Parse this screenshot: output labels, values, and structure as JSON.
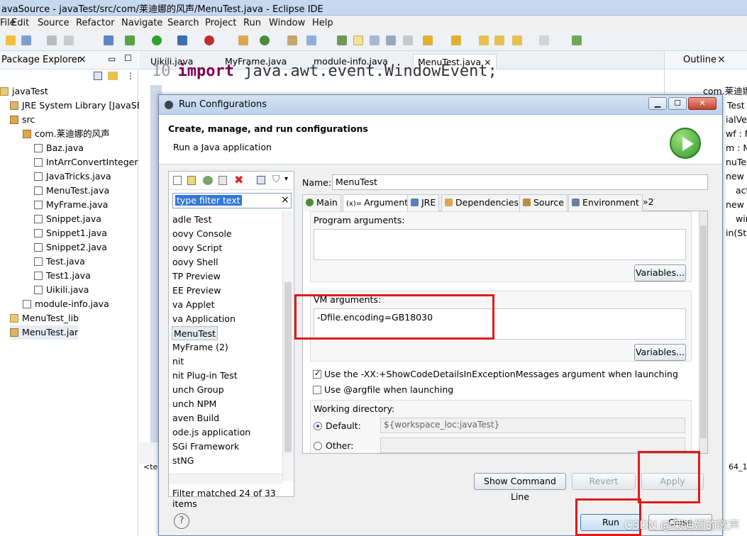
{
  "window": {
    "title": "avaSource - javaTest/src/com/莱迪娜的风声/MenuTest.java - Eclipse IDE"
  },
  "menus": [
    "File",
    "Edit",
    "Source",
    "Refactor",
    "Navigate",
    "Search",
    "Project",
    "Run",
    "Window",
    "Help"
  ],
  "package_explorer": {
    "title": "Package Explorer",
    "items": [
      {
        "label": "javaTest"
      },
      {
        "label": "JRE System Library [JavaSE-"
      },
      {
        "label": "src"
      },
      {
        "label": "com.莱迪娜的风声"
      },
      {
        "label": "Baz.java"
      },
      {
        "label": "IntArrConvertIntegerLi"
      },
      {
        "label": "JavaTricks.java"
      },
      {
        "label": "MenuTest.java"
      },
      {
        "label": "MyFrame.java"
      },
      {
        "label": "Snippet.java"
      },
      {
        "label": "Snippet1.java"
      },
      {
        "label": "Snippet2.java"
      },
      {
        "label": "Test.java"
      },
      {
        "label": "Test1.java"
      },
      {
        "label": "Uikili.java"
      },
      {
        "label": "module-info.java"
      },
      {
        "label": "MenuTest_lib"
      },
      {
        "label": "MenuTest.jar"
      }
    ]
  },
  "editor": {
    "tabs": [
      "Uikili.java",
      "MyFrame.java",
      "module-info.java",
      "MenuTest.java"
    ],
    "line_number": "10",
    "line_keyword": "import",
    "line_text": " java.awt.event.WindowEvent;"
  },
  "outline": {
    "title": "Outline",
    "items": [
      "com.莱迪娜",
      "Test",
      "ialVe",
      "wf : M",
      "m : M",
      "nuTe",
      "new A",
      "act",
      "new W",
      "wir",
      "in(Str"
    ]
  },
  "console_partial": "<te",
  "console_partial2": "64_1",
  "dialog": {
    "title": "Run Configurations",
    "header_title": "Create, manage, and run configurations",
    "header_subtitle": "Run a Java application",
    "filter_placeholder": "type filter text",
    "config_items": [
      "adle Test",
      "oovy Console",
      "oovy Script",
      "oovy Shell",
      "TP Preview",
      "EE Preview",
      "va Applet",
      "va Application",
      "MenuTest",
      "MyFrame (2)",
      "nit",
      "nit Plug-in Test",
      "unch Group",
      "unch NPM",
      "aven Build",
      "ode.js application",
      "SGi Framework",
      "stNG"
    ],
    "filter_status": "Filter matched 24 of 33 items",
    "name_label": "Name:",
    "name_value": "MenuTest",
    "tabs": [
      "Main",
      "Arguments",
      "JRE",
      "Dependencies",
      "Source",
      "Environment",
      "»2"
    ],
    "program_args_label": "Program arguments:",
    "program_args_value": "",
    "variables_label": "Variables...",
    "vm_args_label": "VM arguments:",
    "vm_args_value": "-Dfile.encoding=GB18030",
    "chk_showcode": "Use the -XX:+ShowCodeDetailsInExceptionMessages argument when launching",
    "chk_argfile": "Use @argfile when launching",
    "workdir_label": "Working directory:",
    "default_label": "Default:",
    "default_value": "${workspace_loc:javaTest}",
    "other_label": "Other:",
    "show_cmd": "Show Command Line",
    "revert": "Revert",
    "apply": "Apply",
    "run": "Run",
    "close": "Close",
    "help": "?"
  },
  "watermark": "CSDN @莱迪娜的歌声",
  "colors": {
    "highlight": "#e01b1b",
    "selection": "#3378d6",
    "title_bar": "#c5d8ee"
  }
}
